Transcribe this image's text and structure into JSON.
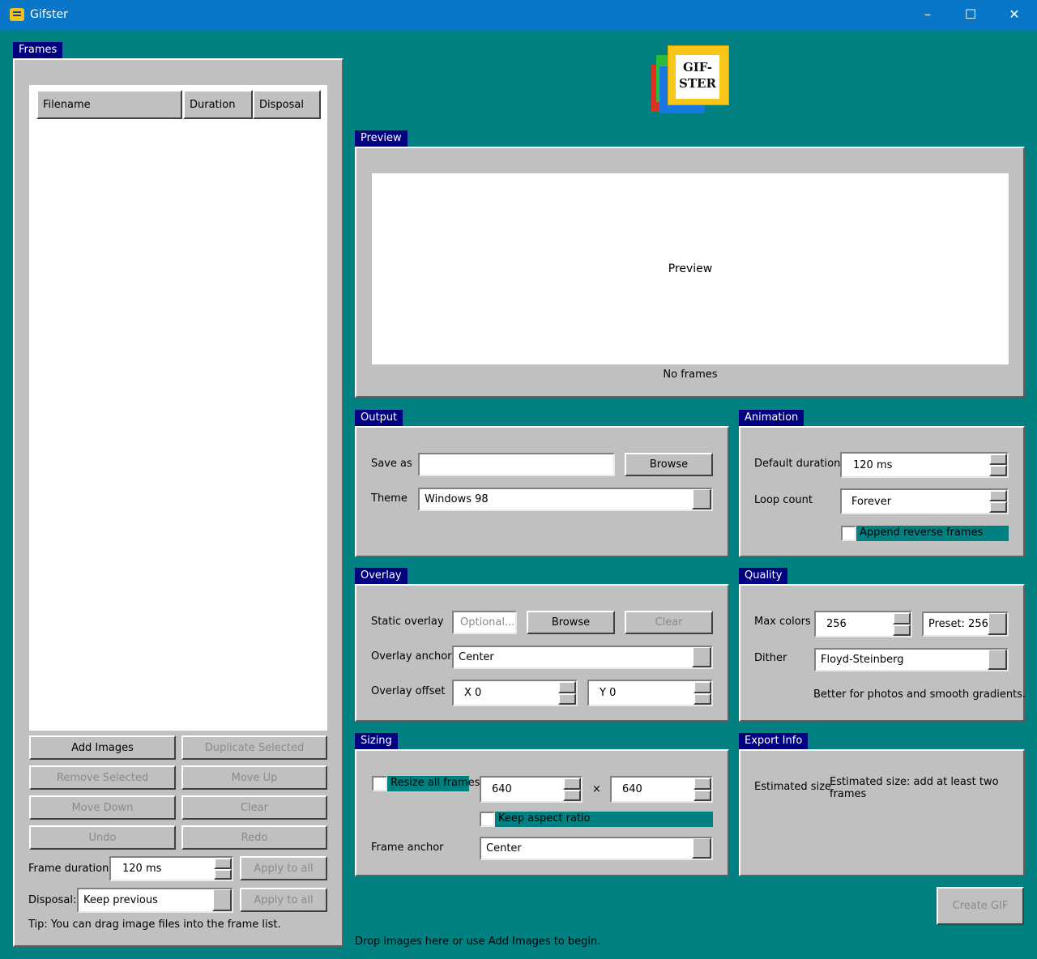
{
  "window": {
    "title": "Gifster",
    "app_icon": "gifster-app-icon",
    "controls": {
      "minimize": "–",
      "maximize": "☐",
      "close": "✕"
    }
  },
  "logo": {
    "line1": "GIF-",
    "line2": "STER"
  },
  "frames": {
    "group_label": "Frames",
    "columns": [
      "Filename",
      "Duration",
      "Disposal"
    ],
    "buttons": {
      "add_images": "Add Images",
      "duplicate_selected": "Duplicate Selected",
      "remove_selected": "Remove Selected",
      "move_up": "Move Up",
      "move_down": "Move Down",
      "clear": "Clear",
      "undo": "Undo",
      "redo": "Redo"
    },
    "frame_duration_label": "Frame duration:",
    "frame_duration_value": "120 ms",
    "apply_to_all": "Apply to all",
    "disposal_label": "Disposal:",
    "disposal_value": "Keep previous",
    "tip": "Tip: You can drag image files into the frame list."
  },
  "preview": {
    "group_label": "Preview",
    "canvas_text": "Preview",
    "status": "No frames"
  },
  "output": {
    "group_label": "Output",
    "save_as_label": "Save as",
    "save_as_value": "",
    "browse": "Browse",
    "theme_label": "Theme",
    "theme_value": "Windows 98"
  },
  "animation": {
    "group_label": "Animation",
    "default_duration_label": "Default duration",
    "default_duration_value": "120 ms",
    "loop_count_label": "Loop count",
    "loop_count_value": "Forever",
    "append_reverse": "Append reverse frames"
  },
  "overlay": {
    "group_label": "Overlay",
    "static_overlay_label": "Static overlay",
    "static_overlay_placeholder": "Optional...",
    "browse": "Browse",
    "clear": "Clear",
    "anchor_label": "Overlay anchor",
    "anchor_value": "Center",
    "offset_label": "Overlay offset",
    "offset_x": "X 0",
    "offset_y": "Y 0"
  },
  "quality": {
    "group_label": "Quality",
    "max_colors_label": "Max colors",
    "max_colors_value": "256",
    "preset_value": "Preset: 256",
    "dither_label": "Dither",
    "dither_value": "Floyd-Steinberg",
    "dither_hint": "Better for photos and smooth gradients."
  },
  "sizing": {
    "group_label": "Sizing",
    "resize_all": "Resize all frames",
    "width": "640",
    "times": "×",
    "height": "640",
    "keep_aspect": "Keep aspect ratio",
    "frame_anchor_label": "Frame anchor",
    "frame_anchor_value": "Center"
  },
  "export_info": {
    "group_label": "Export Info",
    "estimated_size_label": "Estimated size",
    "estimated_size_value": "Estimated size: add at least two frames"
  },
  "create_gif": "Create GIF",
  "status_bar": "Drop images here or use Add Images to begin."
}
